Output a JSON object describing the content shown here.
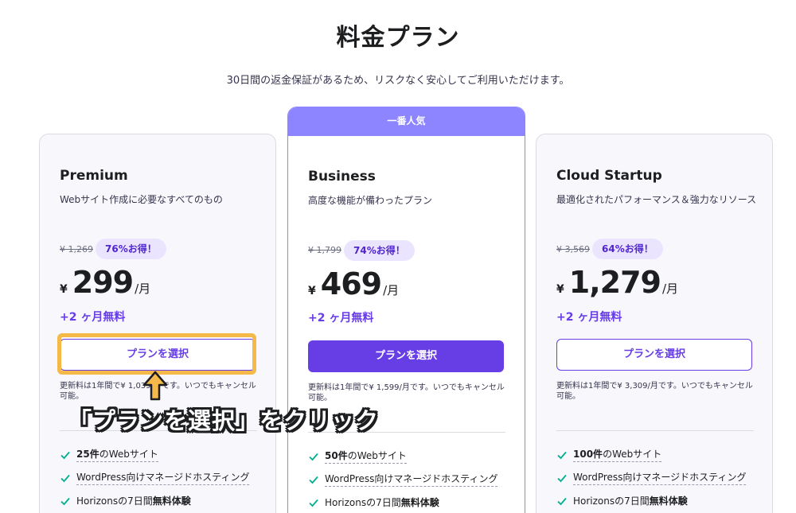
{
  "header": {
    "title": "料金プラン",
    "subtitle": "30日間の返金保証があるため、リスクなく安心してご利用いただけます。"
  },
  "plans": [
    {
      "name": "Premium",
      "description": "Webサイト作成に必要なすべてのもの",
      "old_price": "¥ 1,269",
      "discount": "76%お得！",
      "currency": "¥",
      "price": "299",
      "per": "/月",
      "bonus": "+2 ヶ月無料",
      "button_label": "プランを選択",
      "renewal": "更新料は1年間で¥ 1,039/月です。いつでもキャンセル可能。",
      "features": [
        {
          "bold": "25件",
          "text": "のWebサイト"
        },
        {
          "bold": "",
          "text": "WordPress向けマネージドホスティング"
        },
        {
          "bold_prefix": "Horizonsの7日間",
          "bold": "無料体験",
          "text": ""
        }
      ]
    },
    {
      "name": "Business",
      "popular_label": "一番人気",
      "description": "高度な機能が備わったプラン",
      "old_price": "¥ 1,799",
      "discount": "74%お得！",
      "currency": "¥",
      "price": "469",
      "per": "/月",
      "bonus": "+2 ヶ月無料",
      "button_label": "プランを選択",
      "renewal": "更新料は1年間で¥ 1,599/月です。いつでもキャンセル可能。",
      "features": [
        {
          "bold": "50件",
          "text": "のWebサイト"
        },
        {
          "bold": "",
          "text": "WordPress向けマネージドホスティング"
        },
        {
          "bold_prefix": "Horizonsの7日間",
          "bold": "無料体験",
          "text": ""
        }
      ]
    },
    {
      "name": "Cloud Startup",
      "description": "最適化されたパフォーマンス＆強力なリソース",
      "old_price": "¥ 3,569",
      "discount": "64%お得！",
      "currency": "¥",
      "price": "1,279",
      "per": "/月",
      "bonus": "+2 ヶ月無料",
      "button_label": "プランを選択",
      "renewal": "更新料は1年間で¥ 3,309/月です。いつでもキャンセル可能。",
      "features": [
        {
          "bold": "100件",
          "text": "のWebサイト"
        },
        {
          "bold": "",
          "text": "WordPress向けマネージドホスティング"
        },
        {
          "bold_prefix": "Horizonsの7日間",
          "bold": "無料体験",
          "text": ""
        }
      ]
    }
  ],
  "annotation": {
    "callout": "「プランを選択」をクリック"
  },
  "colors": {
    "accent": "#673de6",
    "popular": "#8c85ff",
    "badge_bg": "#ebe4ff",
    "check": "#00b090",
    "highlight": "#f5b94a"
  }
}
